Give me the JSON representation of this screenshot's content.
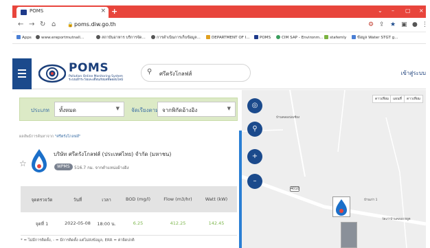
{
  "browser": {
    "tab_title": "POMS",
    "tab_close": "×",
    "new_tab": "+",
    "url": "poms.diw.go.th",
    "window_controls": [
      "⌄",
      "–",
      "▢",
      "×"
    ],
    "nav_icons": [
      "back-icon",
      "forward-icon",
      "reload-icon",
      "home-icon"
    ],
    "bookmarks": [
      {
        "label": "Apps",
        "color": "#4a7fd4"
      },
      {
        "label": "www.ereportmutnall...",
        "color": "#555555"
      },
      {
        "label": "สถาบันอาหาร บริการจัด...",
        "color": "#555555"
      },
      {
        "label": "การดำเนินการเก็บข้อมูล...",
        "color": "#555555"
      },
      {
        "label": "DEPARTMENT OF I...",
        "color": "#e0a020"
      },
      {
        "label": "POMS",
        "color": "#1e3a8a"
      },
      {
        "label": "CIM SAP - Environm...",
        "color": "#3a9d5d"
      },
      {
        "label": "stafemly",
        "color": "#7cb342"
      },
      {
        "label": "ข้อมูล Water STGT g...",
        "color": "#4a7fd4"
      }
    ]
  },
  "header": {
    "logo_text": "POMS",
    "logo_sub_1": "Pollution Online Monitoring System",
    "logo_sub_2": "ระบบเฝ้าระวังและเตือนภัยมลพิษออนไลน์",
    "search_value": "ศรีตรังโกลฟส์",
    "login_label": "เข้าสู่ระบบ",
    "accent": "#1b4a8c"
  },
  "filters": {
    "type_label": "ประเภท",
    "type_value": "ทั้งหมด",
    "sort_label": "จัดเรียงตาม",
    "sort_value": "จากพิกัดอ้างอิง"
  },
  "result": {
    "crumb_prefix": "ผลลัพธ์การค้นหาจาก",
    "crumb_query": "\"ศรีตรังโกลฟส์\"",
    "company": "บริษัท ศรีตรังโกลฟส์ (ประเทศไทย) จำกัด (มหาชน)",
    "badge": "WPMS",
    "distance": "516.7 กม. จากตำแหน่งอ้างอิง"
  },
  "table": {
    "headers": [
      "จุดตรวจวัด",
      "วันที่",
      "เวลา",
      "BOD (mg/l)",
      "Flow (m3/hr)",
      "Watt (kW)"
    ],
    "rows": [
      [
        "จุดที่ 1",
        "2022-05-08",
        "18:00 น.",
        "6.25",
        "412.25",
        "142.45"
      ]
    ],
    "note": "* = ไม่มีการติดตั้ง, - = มีการติดตั้ง แต่ไม่ส่งข้อมูล, ERR = ค่าผิดปกติ"
  },
  "map": {
    "toggles": [
      "ดาวเทียม",
      "แผนที่",
      "ดาวเทียม"
    ],
    "labels": [
      "บ้านคลองบ่อเชียง",
      "บ้านเก่า 1",
      "วัดเก่าบ้านคลองเขยูด"
    ],
    "road_number": "4010",
    "buttons": [
      "target-icon",
      "search-icon",
      "zoom-in-icon",
      "zoom-out-icon"
    ]
  }
}
